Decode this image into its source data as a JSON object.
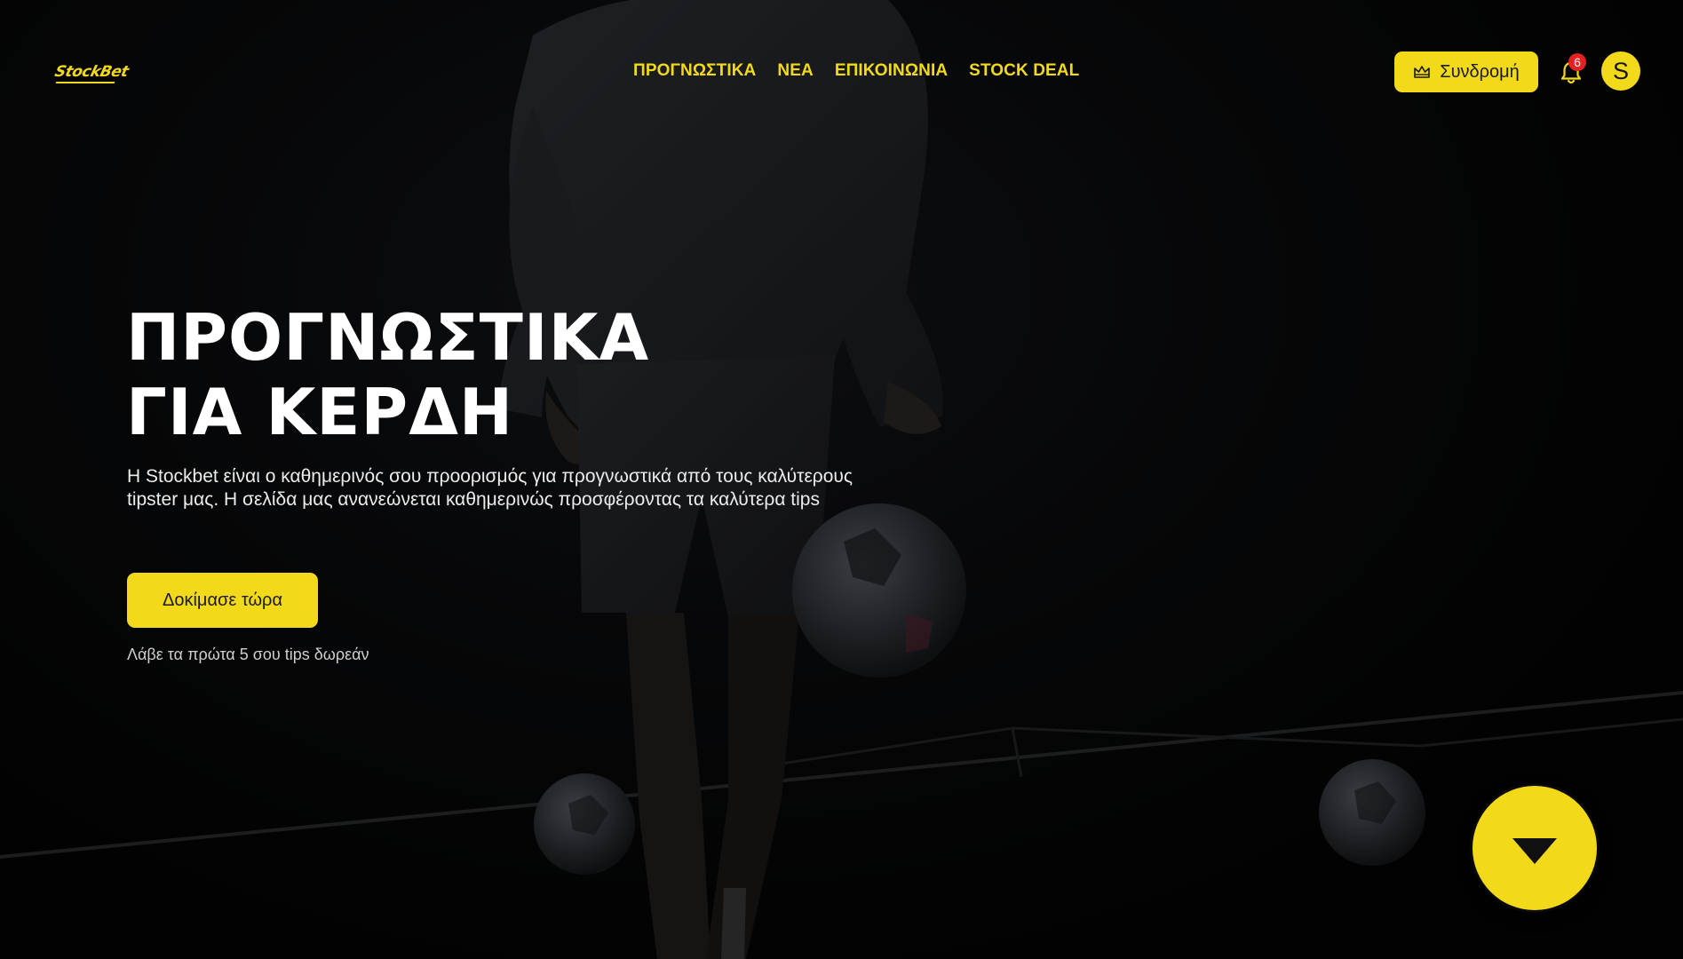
{
  "brand": {
    "logo_text": "StockBet",
    "accent_color": "#f2da1b",
    "badge_color": "#e52222"
  },
  "nav": {
    "items": [
      {
        "label": "ΠΡΟΓΝΩΣΤΙΚΑ"
      },
      {
        "label": "ΝΕΑ"
      },
      {
        "label": "ΕΠΙΚΟΙΝΩΝΙΑ"
      },
      {
        "label": "STOCK DEAL"
      }
    ]
  },
  "header": {
    "subscribe_label": "Συνδρομή",
    "subscribe_icon": "crown-icon",
    "notifications_icon": "bell-icon",
    "notifications_count": "6",
    "avatar_initial": "S"
  },
  "hero": {
    "title_line1": "ΠΡΟΓΝΩΣΤΙΚΑ",
    "title_line2": "ΓΙΑ ΚΕΡΔΗ",
    "description": "Η Stockbet είναι ο καθημερινός σου προορισμός για προγνωστικά από τους καλύτερους tipster μας. Η σελίδα μας ανανεώνεται καθημερινώς προσφέροντας τα καλύτερα tips",
    "cta_label": "Δοκίμασε τώρα",
    "cta_note": "Λάβε τα πρώτα 5 σου tips δωρεάν",
    "scroll_icon": "triangle-down-icon"
  }
}
